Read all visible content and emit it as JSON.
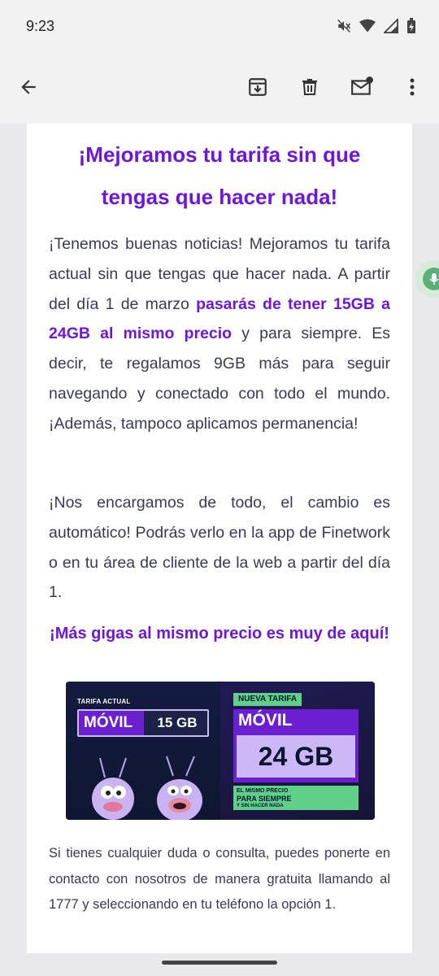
{
  "status_bar": {
    "time": "9:23",
    "icons": [
      "mute-icon",
      "wifi-icon",
      "signal-icon",
      "battery-charging-icon"
    ]
  },
  "toolbar": {
    "icons": [
      "back-arrow-icon",
      "archive-icon",
      "delete-icon",
      "mark-unread-icon",
      "more-vert-icon"
    ]
  },
  "email": {
    "headline_line1": "¡Mejoramos tu tarifa sin que",
    "headline_line2": "tengas que hacer nada!",
    "para1_before": "¡Tenemos buenas noticias! Mejoramos tu tarifa actual sin que tengas que hacer nada. A partir del día 1 de marzo ",
    "para1_highlight": "pasarás de tener 15GB a 24GB al mismo precio",
    "para1_after": " y para siempre. Es decir, te regalamos 9GB más para seguir navegando y conectado con todo el mundo. ¡Además, tampoco aplicamos permanencia!",
    "para2": "¡Nos encargamos de todo, el cambio es automático! Podrás verlo en la app de Finetwork o en tu área de cliente de la web a partir del día 1.",
    "subheadline": "¡Más gigas al mismo precio es muy de aquí!",
    "banner": {
      "tarifa_actual": "TARIFA ACTUAL",
      "movil_old": "MÓVIL",
      "old_gb": "15 GB",
      "nueva_tarifa": "NUEVA TARIFA",
      "movil_new": "MÓVIL",
      "new_gb": "24 GB",
      "mismo_precio": "EL MISMO PRECIO",
      "para_siempre": "PARA SIEMPRE",
      "sin_hacer": "Y SIN HACER NADA"
    },
    "para3": "Si tienes cualquier duda o consulta, puedes ponerte en contacto con nosotros de manera gratuita llamando al 1777 y seleccionando en tu teléfono la opción 1."
  },
  "colors": {
    "accent_purple": "#6d18d6",
    "body_text": "#3a3a52",
    "banner_green": "#5ed08a",
    "banner_lilac": "#cdb8f6"
  }
}
